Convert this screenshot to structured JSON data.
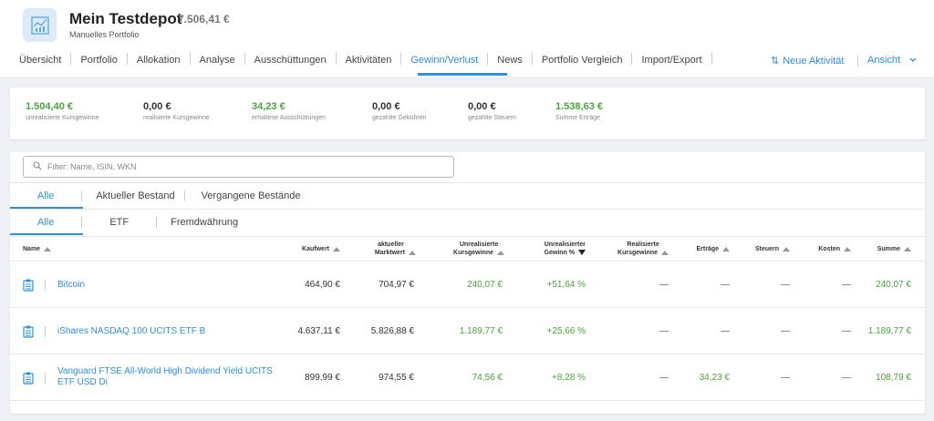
{
  "portfolio": {
    "title": "Mein Testdepot",
    "value": "7.506,41 €",
    "subtitle": "Manuelles Portfolio",
    "logo_icon": "chart-icon"
  },
  "nav": {
    "items": [
      "Übersicht",
      "Portfolio",
      "Allokation",
      "Analyse",
      "Ausschüttungen",
      "Aktivitäten",
      "Gewinn/Verlust",
      "News",
      "Portfolio Vergleich",
      "Import/Export"
    ],
    "active": "Gewinn/Verlust",
    "new_activity": "Neue Aktivität",
    "view": "Ansicht"
  },
  "summary": [
    {
      "value": "1.504,40 €",
      "label": "unrealisierte Kursgewinne",
      "green": true
    },
    {
      "value": "0,00 €",
      "label": "realisierte Kursgewinne",
      "green": false
    },
    {
      "value": "34,23 €",
      "label": "erhaltene Ausschüttungen",
      "green": true
    },
    {
      "value": "0,00 €",
      "label": "gezahlte Gebühren",
      "green": false
    },
    {
      "value": "0,00 €",
      "label": "gezahlte Steuern",
      "green": false
    },
    {
      "value": "1.538,63 €",
      "label": "Summe Erträge",
      "green": true
    }
  ],
  "filter": {
    "placeholder": "Filter: Name, ISIN, WKN"
  },
  "tabs1": [
    "Alle",
    "Aktueller Bestand",
    "Vergangene Bestände"
  ],
  "tabs2": [
    "Alle",
    "ETF",
    "Fremdwährung"
  ],
  "columns": {
    "name": "Name",
    "kaufwert": "Kaufwert",
    "aktueller1": "aktueller",
    "aktueller2": "Marktwert",
    "unreal1": "Unrealisierte",
    "unreal2": "Kursgewinne",
    "unrealp1": "Unrealisierter",
    "unrealp2": "Gewinn %",
    "real1": "Realisierte",
    "real2": "Kursgewinne",
    "ertraege": "Erträge",
    "steuern": "Steuern",
    "kosten": "Kosten",
    "summe": "Summe"
  },
  "rows": [
    {
      "name": "Bitcoin",
      "kaufwert": "464,90 €",
      "marktwert": "704,97 €",
      "unreal": "240,07 €",
      "unrealp": "+51,64 %",
      "real": "—",
      "ertraege": "—",
      "steuern": "—",
      "kosten": "—",
      "summe": "240,07 €"
    },
    {
      "name": "iShares NASDAQ 100 UCITS ETF B",
      "kaufwert": "4.637,11 €",
      "marktwert": "5.826,88 €",
      "unreal": "1.189,77 €",
      "unrealp": "+25,66 %",
      "real": "—",
      "ertraege": "—",
      "steuern": "—",
      "kosten": "—",
      "summe": "1.189,77 €"
    },
    {
      "name": "Vanguard FTSE All-World High Dividend Yield UCITS ETF USD Di",
      "kaufwert": "899,99 €",
      "marktwert": "974,55 €",
      "unreal": "74,56 €",
      "unrealp": "+8,28 %",
      "real": "—",
      "ertraege": "34,23 €",
      "steuern": "—",
      "kosten": "—",
      "summe": "108,79 €"
    }
  ],
  "colors": {
    "accent": "#2d8fd8",
    "positive": "#4aa43a"
  }
}
